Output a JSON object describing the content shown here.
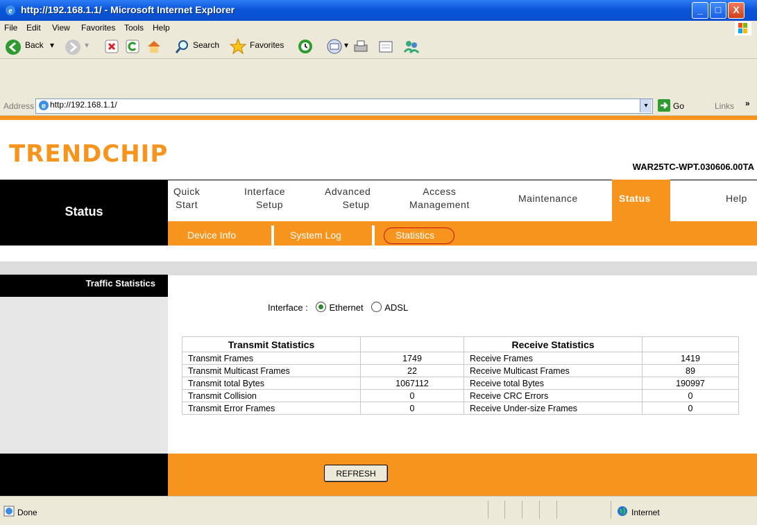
{
  "window": {
    "title": "http://192.168.1.1/ - Microsoft Internet Explorer",
    "min_label": "_",
    "max_label": "□",
    "close_label": "X"
  },
  "menu": [
    "File",
    "Edit",
    "View",
    "Favorites",
    "Tools",
    "Help"
  ],
  "toolbar": {
    "back": "Back",
    "search": "Search",
    "favorites": "Favorites"
  },
  "address": {
    "label": "Address",
    "url": "http://192.168.1.1/",
    "go": "Go",
    "links": "Links"
  },
  "brand": {
    "logo": "TRENDCHIP",
    "firmware": "WAR25TC-WPT.030606.00TA"
  },
  "section_title": "Status",
  "nav": [
    {
      "line1": "Quick",
      "line2": "Start"
    },
    {
      "line1": "Interface",
      "line2": "Setup"
    },
    {
      "line1": "Advanced",
      "line2": "Setup"
    },
    {
      "line1": "Access",
      "line2": "Management"
    },
    {
      "line1": "Maintenance",
      "line2": ""
    },
    {
      "line1": "Status",
      "line2": ""
    },
    {
      "line1": "Help",
      "line2": ""
    }
  ],
  "subnav": [
    "Device Info",
    "System Log",
    "Statistics"
  ],
  "side_title": "Traffic Statistics",
  "interface": {
    "label": "Interface :",
    "options": [
      "Ethernet",
      "ADSL"
    ],
    "selected": "Ethernet"
  },
  "stats": {
    "tx_header": "Transmit Statistics",
    "rx_header": "Receive Statistics",
    "rows": [
      {
        "tx_label": "Transmit Frames",
        "tx_value": "1749",
        "rx_label": "Receive Frames",
        "rx_value": "1419"
      },
      {
        "tx_label": "Transmit Multicast Frames",
        "tx_value": "22",
        "rx_label": "Receive Multicast Frames",
        "rx_value": "89"
      },
      {
        "tx_label": "Transmit total Bytes",
        "tx_value": "1067112",
        "rx_label": "Receive total Bytes",
        "rx_value": "190997"
      },
      {
        "tx_label": "Transmit Collision",
        "tx_value": "0",
        "rx_label": "Receive CRC Errors",
        "rx_value": "0"
      },
      {
        "tx_label": "Transmit Error Frames",
        "tx_value": "0",
        "rx_label": "Receive Under-size Frames",
        "rx_value": "0"
      }
    ]
  },
  "refresh_label": "REFRESH",
  "statusbar": {
    "left": "Done",
    "zone": "Internet"
  },
  "colors": {
    "accent": "#f7941d",
    "title_bar": "#0a55d8"
  }
}
